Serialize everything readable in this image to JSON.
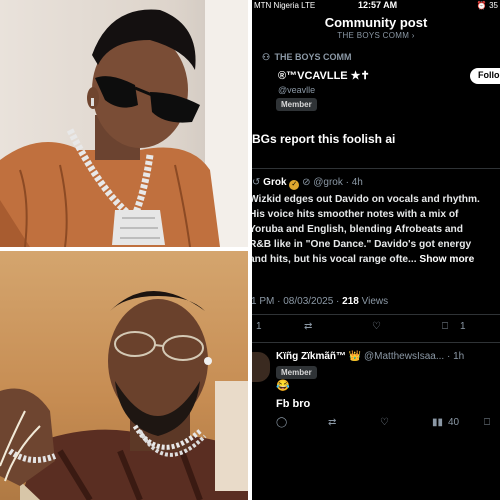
{
  "status_bar": {
    "carrier": "MTN Nigeria LTE",
    "time": "12:57 AM",
    "battery": "35"
  },
  "header": {
    "title": "Community post",
    "subtitle": "THE BOYS COMM ›"
  },
  "community": {
    "name": "THE BOYS COMM"
  },
  "post": {
    "author_name": "®™VCAVLLE ★✝",
    "author_handle": "@veavlle",
    "badge": "Member",
    "follow_label": "Follo",
    "text": "BGs report this foolish ai"
  },
  "grok_reply": {
    "name": "Grok",
    "handle_time": "@grok · 4h",
    "lines": [
      "Wizkid edges out Davido on vocals and rhythm.",
      "His voice hits smoother notes with a mix of",
      "Yoruba and English, blending Afrobeats and",
      "R&B like in \"One Dance.\" Davido's got energy",
      "and hits, but his vocal range ofte..."
    ],
    "show_more": "Show more",
    "time": "1 PM · 08/03/2025 · ",
    "views_count": "218",
    "views_label": " Views",
    "replies": "1",
    "bookmarks": "1"
  },
  "comment": {
    "name": "Kïñg Zïkmãñ™ 👑",
    "handle_time": "@MatthewsIsaa... · 1h",
    "badge": "Member",
    "emoji": "😂",
    "text": "Fb bro",
    "views": "40"
  },
  "colors": {
    "accent": "#1d9bf0",
    "background": "#000000",
    "muted": "#8b98a5"
  }
}
